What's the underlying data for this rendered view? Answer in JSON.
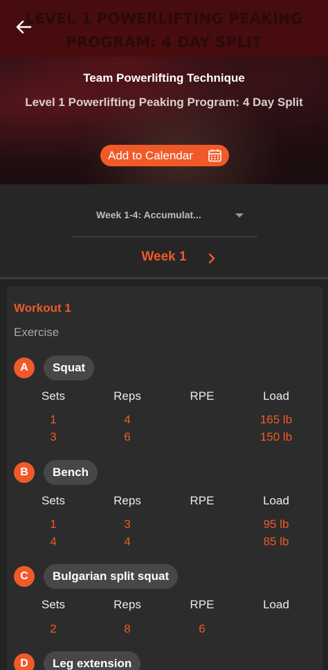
{
  "header": {
    "banner_title": "Level 1 Powerlifting Peaking Program: 4 Day Split",
    "subtitle": "Team Powerlifting Technique",
    "program_name": "Level 1 Powerlifting Peaking Program: 4 Day Split",
    "calendar_button": "Add to Calendar"
  },
  "week_selector": {
    "phase_value": "Week 1-4:  Accumulat...",
    "week_label": "Week 1"
  },
  "colors": {
    "accent": "#f05a28",
    "background": "#222222",
    "card": "#2c2c2c"
  },
  "workout": {
    "title": "Workout 1",
    "caption": "Exercise",
    "columns": {
      "sets": "Sets",
      "reps": "Reps",
      "rpe": "RPE",
      "load": "Load"
    },
    "exercises": [
      {
        "letter": "A",
        "name": "Squat",
        "rows": [
          {
            "sets": "1",
            "reps": "4",
            "rpe": "",
            "load": "165 lb"
          },
          {
            "sets": "3",
            "reps": "6",
            "rpe": "",
            "load": "150 lb"
          }
        ]
      },
      {
        "letter": "B",
        "name": "Bench",
        "rows": [
          {
            "sets": "1",
            "reps": "3",
            "rpe": "",
            "load": "95 lb"
          },
          {
            "sets": "4",
            "reps": "4",
            "rpe": "",
            "load": "85 lb"
          }
        ]
      },
      {
        "letter": "C",
        "name": "Bulgarian split squat",
        "rows": [
          {
            "sets": "2",
            "reps": "8",
            "rpe": "6",
            "load": ""
          }
        ]
      },
      {
        "letter": "D",
        "name": "Leg extension",
        "rows": []
      }
    ]
  }
}
